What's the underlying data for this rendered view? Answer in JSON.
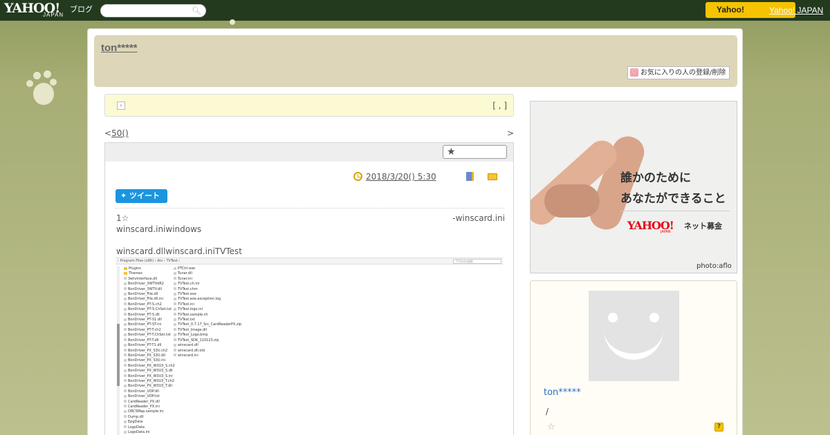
{
  "topbar": {
    "logo": "YAHOO!",
    "logo_sub": "JAPAN",
    "logo_blog": "ブログ",
    "search_placeholder": "",
    "right_button": "Yahoo!",
    "right_link": "Yahoo! JAPAN"
  },
  "header": {
    "blog_title": "ton*****",
    "favorite_button": "お気に入りの人の登録/削除"
  },
  "notice": {
    "right_text": "[ , ]"
  },
  "pager": {
    "prev_symbol": "<",
    "prev_link": "50()",
    "next_symbol": ">"
  },
  "article": {
    "date": "2018/3/20()  5:30",
    "tweet_label": "ツイート",
    "line1_left": "1☆",
    "line1_right": "-winscard.ini",
    "line2": "winscard.iniwindows",
    "line3": "winscard.dllwinscard.iniTVTest",
    "screenshot": {
      "path": "›  Program Files (x86)  ›  dtv  ›  TVTest  ›",
      "search_placeholder": "TVTestの検索",
      "left_column": [
        {
          "name": "Plugins",
          "type": "folder"
        },
        {
          "name": "Themes",
          "type": "folder"
        },
        {
          "name": "3wtvInterface.dll",
          "type": "file"
        },
        {
          "name": "BonDriver_3WTVdR2",
          "type": "file"
        },
        {
          "name": "BonDriver_3WTV.dll",
          "type": "file"
        },
        {
          "name": "BonDriver_File.dll",
          "type": "file"
        },
        {
          "name": "BonDriver_File.dll.ini",
          "type": "file"
        },
        {
          "name": "BonDriver_PT-S.ch2",
          "type": "file"
        },
        {
          "name": "BonDriver_PT-S.ChSet.txt",
          "type": "file"
        },
        {
          "name": "BonDriver_PT-S.dll",
          "type": "file"
        },
        {
          "name": "BonDriver_PT-S1.dll",
          "type": "file"
        },
        {
          "name": "BonDriver_PT-ST.ini",
          "type": "file"
        },
        {
          "name": "BonDriver_PT-T.ch2",
          "type": "file"
        },
        {
          "name": "BonDriver_PT-T.ChSet.txt",
          "type": "file"
        },
        {
          "name": "BonDriver_PT-T.dll",
          "type": "file"
        },
        {
          "name": "BonDriver_PT-T1.dll",
          "type": "file"
        },
        {
          "name": "BonDriver_PX_S3U.ch2",
          "type": "file"
        },
        {
          "name": "BonDriver_PX_S3U.dll",
          "type": "file"
        },
        {
          "name": "BonDriver_PX_S3U.ini",
          "type": "file"
        },
        {
          "name": "BonDriver_PX_W3U3_S.ch2",
          "type": "file"
        },
        {
          "name": "BonDriver_PX_W3U3_S.dll",
          "type": "file"
        },
        {
          "name": "BonDriver_PX_W3U3_S.ini",
          "type": "file"
        },
        {
          "name": "BonDriver_PX_W3U3_T.ch2",
          "type": "file"
        },
        {
          "name": "BonDriver_PX_W3U3_T.dll",
          "type": "file"
        },
        {
          "name": "BonDriver_UDP.dll",
          "type": "file"
        },
        {
          "name": "BonDriver_UDP.txt",
          "type": "file"
        },
        {
          "name": "CardReader_PX.dll",
          "type": "file"
        },
        {
          "name": "CardReader_PX.ini",
          "type": "file"
        },
        {
          "name": "DRCSMap.sample.ini",
          "type": "file"
        },
        {
          "name": "Dump.dll",
          "type": "file"
        },
        {
          "name": "EpgData",
          "type": "file"
        },
        {
          "name": "LogoData",
          "type": "file"
        },
        {
          "name": "LogoData.ini",
          "type": "file"
        }
      ],
      "right_column": [
        {
          "name": "PTCtrl.exe",
          "type": "file"
        },
        {
          "name": "Tuner.dll",
          "type": "file"
        },
        {
          "name": "Tuner.ini",
          "type": "file"
        },
        {
          "name": "TVTest.ch.ini",
          "type": "file"
        },
        {
          "name": "TVTest.chm",
          "type": "file"
        },
        {
          "name": "TVTest.exe",
          "type": "file"
        },
        {
          "name": "TVTest.exe.exception.log",
          "type": "file"
        },
        {
          "name": "TVTest.ini",
          "type": "file"
        },
        {
          "name": "TVTest.logo.ini",
          "type": "file"
        },
        {
          "name": "TVTest.sample.ch",
          "type": "file"
        },
        {
          "name": "TVTest.txt",
          "type": "file"
        },
        {
          "name": "TVTest_0.7.17_Src_CardReaderPX.zip",
          "type": "file"
        },
        {
          "name": "TVTest_Image.dll",
          "type": "file"
        },
        {
          "name": "TVTest_Logo.bmp",
          "type": "file"
        },
        {
          "name": "TVTest_SDK_110123.zip",
          "type": "file"
        },
        {
          "name": "winscard.dll",
          "type": "file"
        },
        {
          "name": "winscard.dll.old",
          "type": "file"
        },
        {
          "name": "winscard.ini",
          "type": "file"
        }
      ]
    }
  },
  "sidebar": {
    "ad": {
      "line1": "誰かのために",
      "line2": "あなたができること",
      "logo": "YAHOO!",
      "logo_sub": "JAPAN",
      "tagline": "ネット募金",
      "credit": "photo:aflo"
    },
    "profile": {
      "name": "ton*****",
      "slash": "/"
    }
  },
  "colors": {
    "topbar": "#233a1f",
    "header_box": "#ddd6b8",
    "notice_bg": "#fbfad3",
    "tweet_blue": "#1b95e0",
    "link_blue": "#2a6ebd",
    "yahoo_red": "#e60012",
    "accent_yellow": "#f5c300"
  },
  "icons": [
    "search-icon",
    "paw-icon",
    "heart-icon",
    "notice-icon",
    "star-icon",
    "clock-icon",
    "book-icon",
    "folder-icon",
    "twitter-icon",
    "avatar-face-icon",
    "star-outline-icon",
    "help-icon"
  ]
}
